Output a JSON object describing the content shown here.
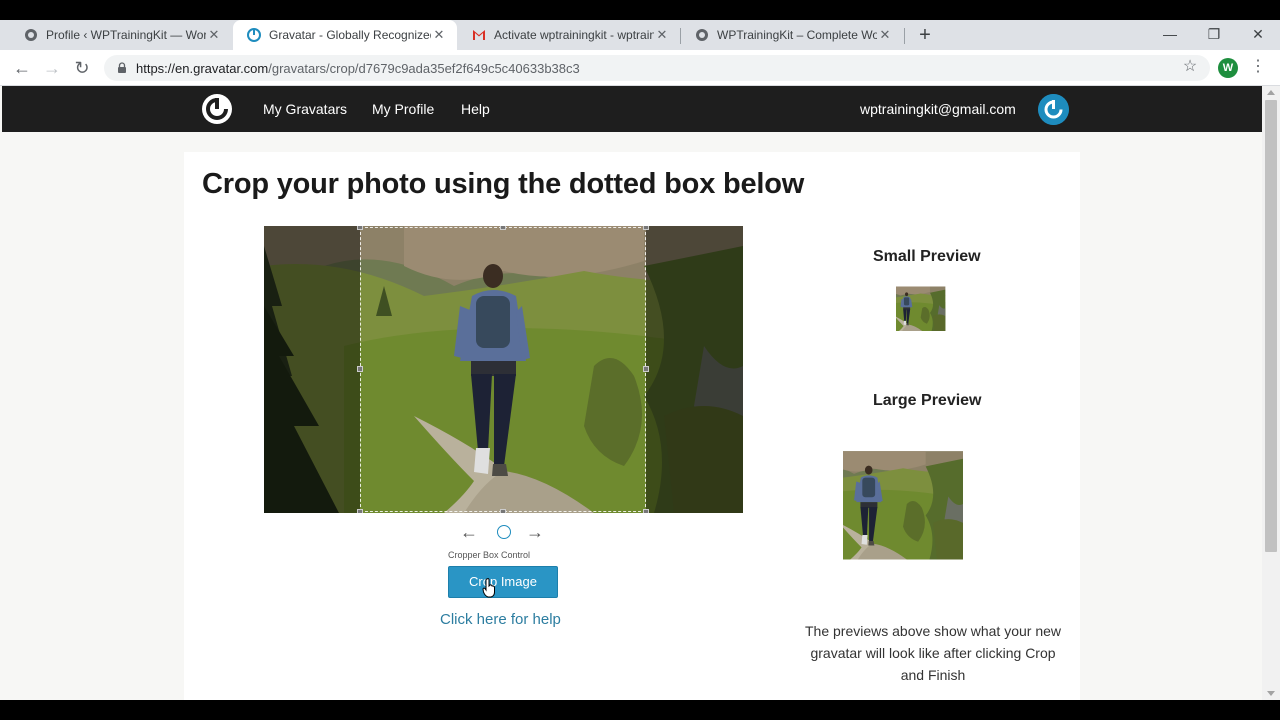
{
  "browser": {
    "tabs": [
      {
        "title": "Profile ‹ WPTrainingKit — WordPress",
        "icon": "wordpress-globe-icon",
        "active": false
      },
      {
        "title": "Gravatar - Globally Recognized Avatars",
        "icon": "gravatar-icon",
        "active": true
      },
      {
        "title": "Activate wptrainingkit - wptrainingkit@gmail.com",
        "icon": "gmail-icon",
        "active": false
      },
      {
        "title": "WPTrainingKit – Complete WordPress",
        "icon": "wordpress-globe-icon",
        "active": false
      }
    ],
    "url_host": "https://en.gravatar.com",
    "url_path": "/gravatars/crop/d7679c9ada35ef2f649c5c40633b38c3",
    "profile_initial": "W"
  },
  "site": {
    "nav": [
      "My Gravatars",
      "My Profile",
      "Help"
    ],
    "user_email": "wptrainingkit@gmail.com",
    "brand_color": "#1e8cbe",
    "header_color": "#1e1e1e"
  },
  "crop": {
    "heading": "Crop your photo using the dotted box below",
    "cropper_label": "Cropper Box Control",
    "crop_button": "Crop Image",
    "help_link": "Click here for help",
    "arrow_left": "←",
    "arrow_right": "→"
  },
  "preview": {
    "small_title": "Small Preview",
    "large_title": "Large Preview",
    "note": "The previews above show what your new gravatar will look like after clicking Crop and Finish"
  }
}
